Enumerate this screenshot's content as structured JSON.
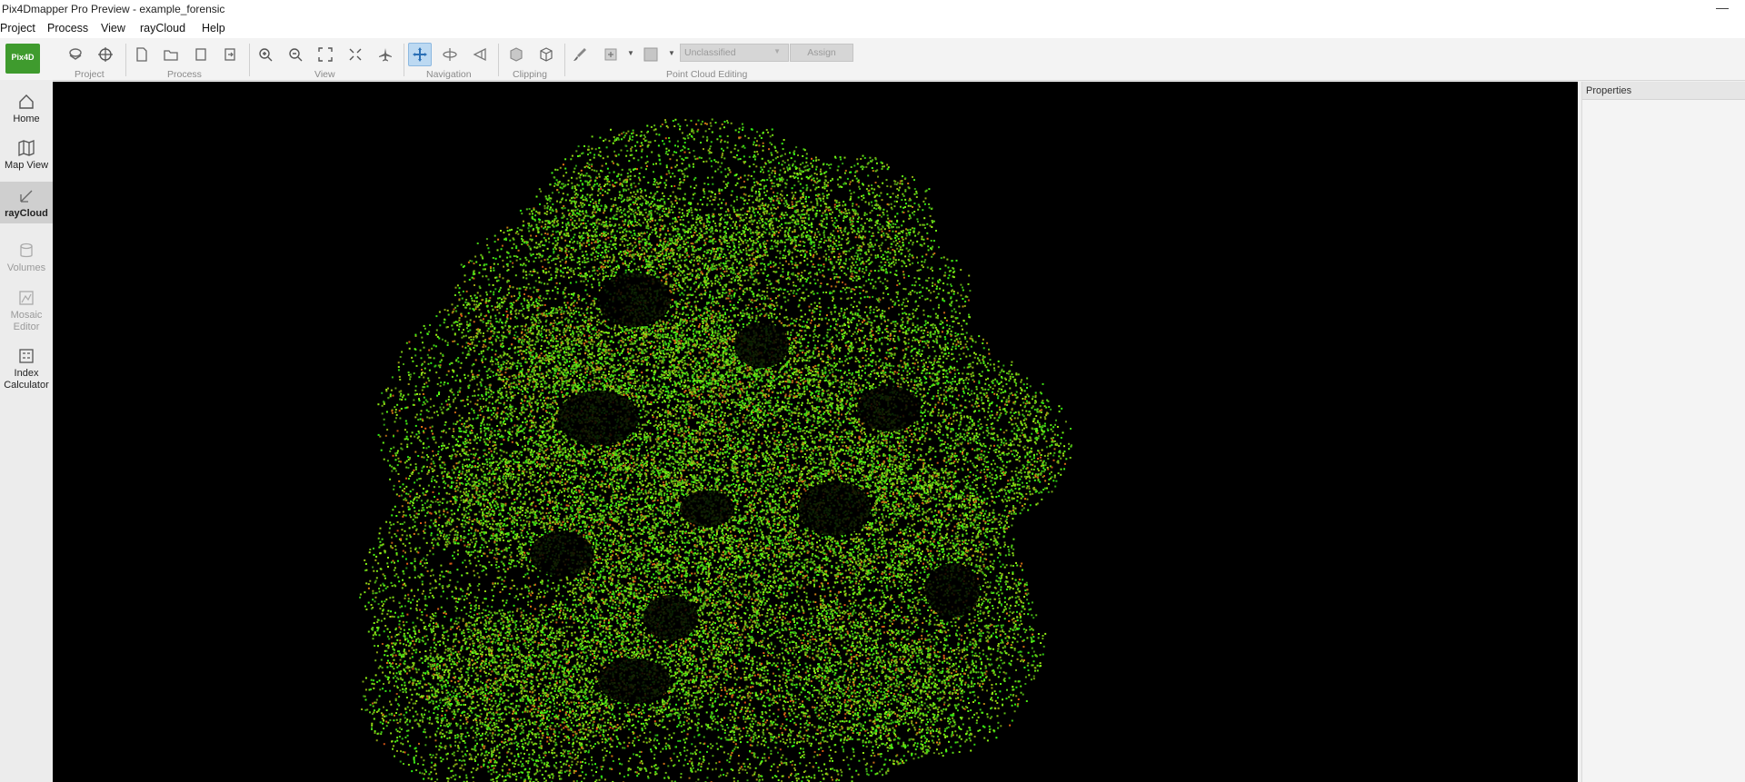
{
  "window": {
    "title": "Pix4Dmapper Pro Preview - example_forensic",
    "minimize_glyph": "—"
  },
  "menu": [
    "Project",
    "Process",
    "View",
    "rayCloud",
    "Help"
  ],
  "logo_text": "Pix4D",
  "toolbar": {
    "groups": [
      "Project",
      "Process",
      "View",
      "Navigation",
      "Clipping",
      "Point Cloud Editing"
    ],
    "class_dropdown": "Unclassified",
    "assign_label": "Assign"
  },
  "sidebar": [
    {
      "label": "Home",
      "icon": "home-icon",
      "state": "normal"
    },
    {
      "label": "Map View",
      "icon": "map-icon",
      "state": "normal"
    },
    {
      "label": "rayCloud",
      "icon": "raycloud-icon",
      "state": "selected"
    },
    {
      "label": "Volumes",
      "icon": "volumes-icon",
      "state": "disabled"
    },
    {
      "label": "Mosaic Editor",
      "icon": "mosaic-icon",
      "state": "disabled"
    },
    {
      "label": "Index Calculator",
      "icon": "index-calculator-icon",
      "state": "normal"
    }
  ],
  "properties": {
    "title": "Properties"
  },
  "colors": {
    "accent": "#3f9b2e",
    "viewport_bg": "#000000",
    "point_green": "#5fd21c",
    "point_orange": "#d06a1a"
  }
}
